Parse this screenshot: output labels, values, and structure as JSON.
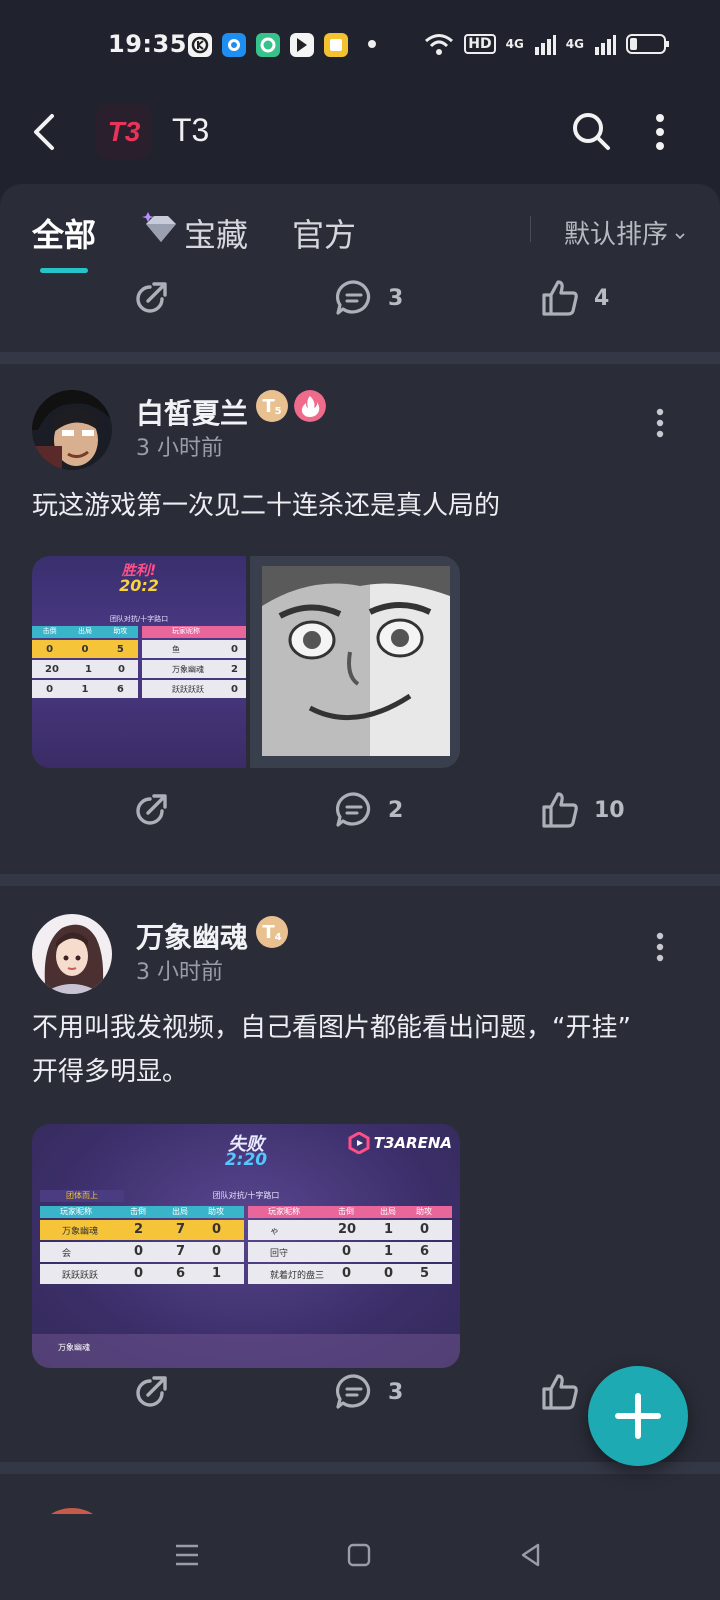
{
  "status_bar": {
    "time": "19:35",
    "network": "HD",
    "signal_labels": [
      "4G",
      "4G"
    ]
  },
  "app_bar": {
    "logo_text": "T3",
    "title": "T3"
  },
  "tabs": {
    "items": [
      {
        "label": "全部",
        "active": true
      },
      {
        "label": "宝藏",
        "active": false
      },
      {
        "label": "官方",
        "active": false
      }
    ],
    "sort_label": "默认排序"
  },
  "top_actions": {
    "comments": "3",
    "likes": "4"
  },
  "posts": [
    {
      "author": "白皙夏兰",
      "level_badge": "T",
      "level_num": "5",
      "time": "3 小时前",
      "text": "玩这游戏第一次见二十连杀还是真人局的",
      "image1": {
        "result": "胜利!",
        "score": "20:2",
        "mode": "团队对抗/十字路口",
        "headers": [
          "击倒",
          "出局",
          "助攻"
        ],
        "left_rows": [
          [
            "0",
            "0",
            "5"
          ],
          [
            "20",
            "1",
            "0"
          ],
          [
            "0",
            "1",
            "6"
          ]
        ],
        "right_header": "玩家昵称",
        "right_rows": [
          [
            "鱼",
            "0"
          ],
          [
            "万象幽魂",
            "2"
          ],
          [
            "跃跃跃跃",
            "0"
          ]
        ]
      },
      "comments": "2",
      "likes": "10"
    },
    {
      "author": "万象幽魂",
      "level_badge": "T",
      "level_num": "4",
      "time": "3 小时前",
      "text_line1": "不用叫我发视频，自己看图片都能看出问题，“开挂”",
      "text_line2": "开得多明显。",
      "image": {
        "result": "失败",
        "score": "2:20",
        "brand": "T3ARENA",
        "mode": "团队对抗/十字路口",
        "tag": "团体而上",
        "headers": [
          "玩家昵称",
          "击倒",
          "出局",
          "助攻"
        ],
        "left_rows": [
          {
            "name": "万象幽魂",
            "k": "2",
            "d": "7",
            "a": "0"
          },
          {
            "name": "会",
            "k": "0",
            "d": "7",
            "a": "0"
          },
          {
            "name": "跃跃跃跃",
            "k": "0",
            "d": "6",
            "a": "1"
          }
        ],
        "right_rows": [
          {
            "name": "ゃ",
            "k": "20",
            "d": "1",
            "a": "0"
          },
          {
            "name": "回守",
            "k": "0",
            "d": "1",
            "a": "6"
          },
          {
            "name": "就着灯的盘三",
            "k": "0",
            "d": "0",
            "a": "5"
          }
        ],
        "footer_name": "万象幽魂"
      },
      "comments": "3"
    }
  ],
  "colors": {
    "background": "#20232e",
    "card": "#2a2d38",
    "accent": "#26c3c9",
    "fab": "#1eaab3",
    "logo": "#e8345a"
  },
  "icons": [
    "back-icon",
    "search-icon",
    "more-icon",
    "share-icon",
    "comment-icon",
    "like-icon",
    "plus-icon",
    "menu-icon",
    "home-icon",
    "back-nav-icon"
  ]
}
